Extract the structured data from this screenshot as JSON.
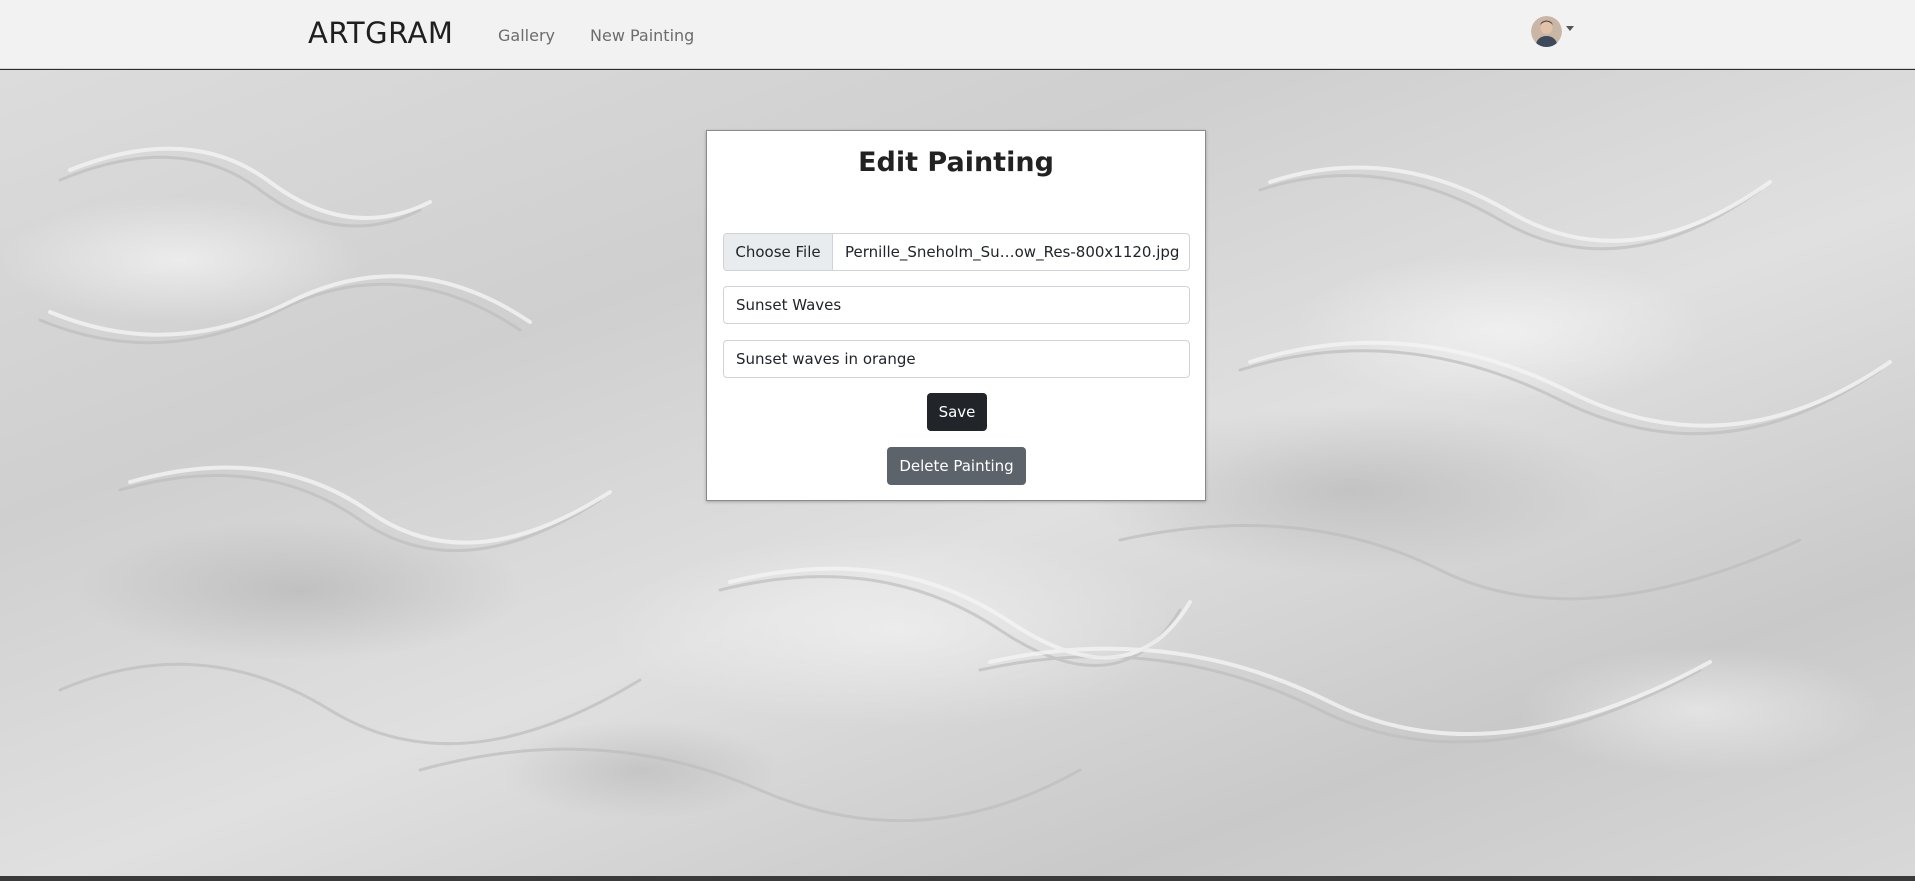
{
  "navbar": {
    "brand": "ARTGRAM",
    "links": {
      "gallery": "Gallery",
      "new_painting": "New Painting"
    },
    "user_menu": {
      "avatar_icon": "user-avatar-icon",
      "caret_icon": "caret-down-icon"
    }
  },
  "form": {
    "title": "Edit Painting",
    "file_input": {
      "button_label": "Choose File",
      "file_name": "Pernille_Sneholm_Su…ow_Res-800x1120.jpg"
    },
    "title_field": {
      "value": "Sunset Waves"
    },
    "description_field": {
      "value": "Sunset waves in orange"
    },
    "save_label": "Save",
    "delete_label": "Delete Painting"
  },
  "colors": {
    "navbar_bg": "#f2f2f2",
    "save_button": "#212529",
    "delete_button": "#5c636a",
    "background_texture": "#d6d6d6"
  }
}
